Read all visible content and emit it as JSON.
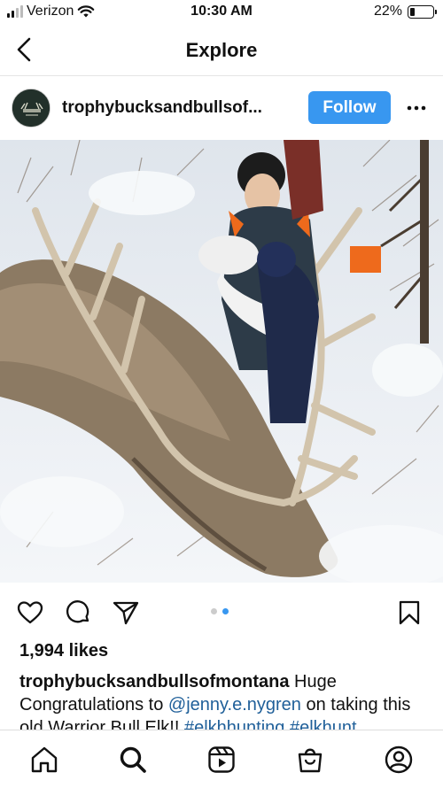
{
  "status_bar": {
    "carrier": "Verizon",
    "time": "10:30 AM",
    "battery_text": "22%",
    "battery_level": 0.22,
    "icons": [
      "signal-icon",
      "wifi-icon",
      "battery-icon"
    ]
  },
  "header": {
    "title": "Explore",
    "back_icon": "chevron-left-icon"
  },
  "post": {
    "username": "trophybucksandbullsof...",
    "follow_label": "Follow",
    "more_icon": "more-horizontal-icon",
    "carousel": {
      "count": 2,
      "active_index": 1
    },
    "likes": "1,994 likes",
    "caption": {
      "user": "trophybucksandbullsofmontana",
      "text_1": " Huge Congratulations to ",
      "mention": "@jenny.e.nygren",
      "text_2": " on taking this old Warrior Bull Elk!! ",
      "tag_1": "#elkhhunting",
      "tag_2": "#elkhunt"
    }
  },
  "action_icons": [
    "heart-icon",
    "comment-icon",
    "share-icon",
    "bookmark-icon"
  ],
  "bottom_nav_icons": [
    "home-icon",
    "search-icon",
    "reels-icon",
    "shop-icon",
    "profile-icon"
  ],
  "colors": {
    "accent": "#3897f0",
    "link": "#1f5f99",
    "text": "#111111"
  }
}
